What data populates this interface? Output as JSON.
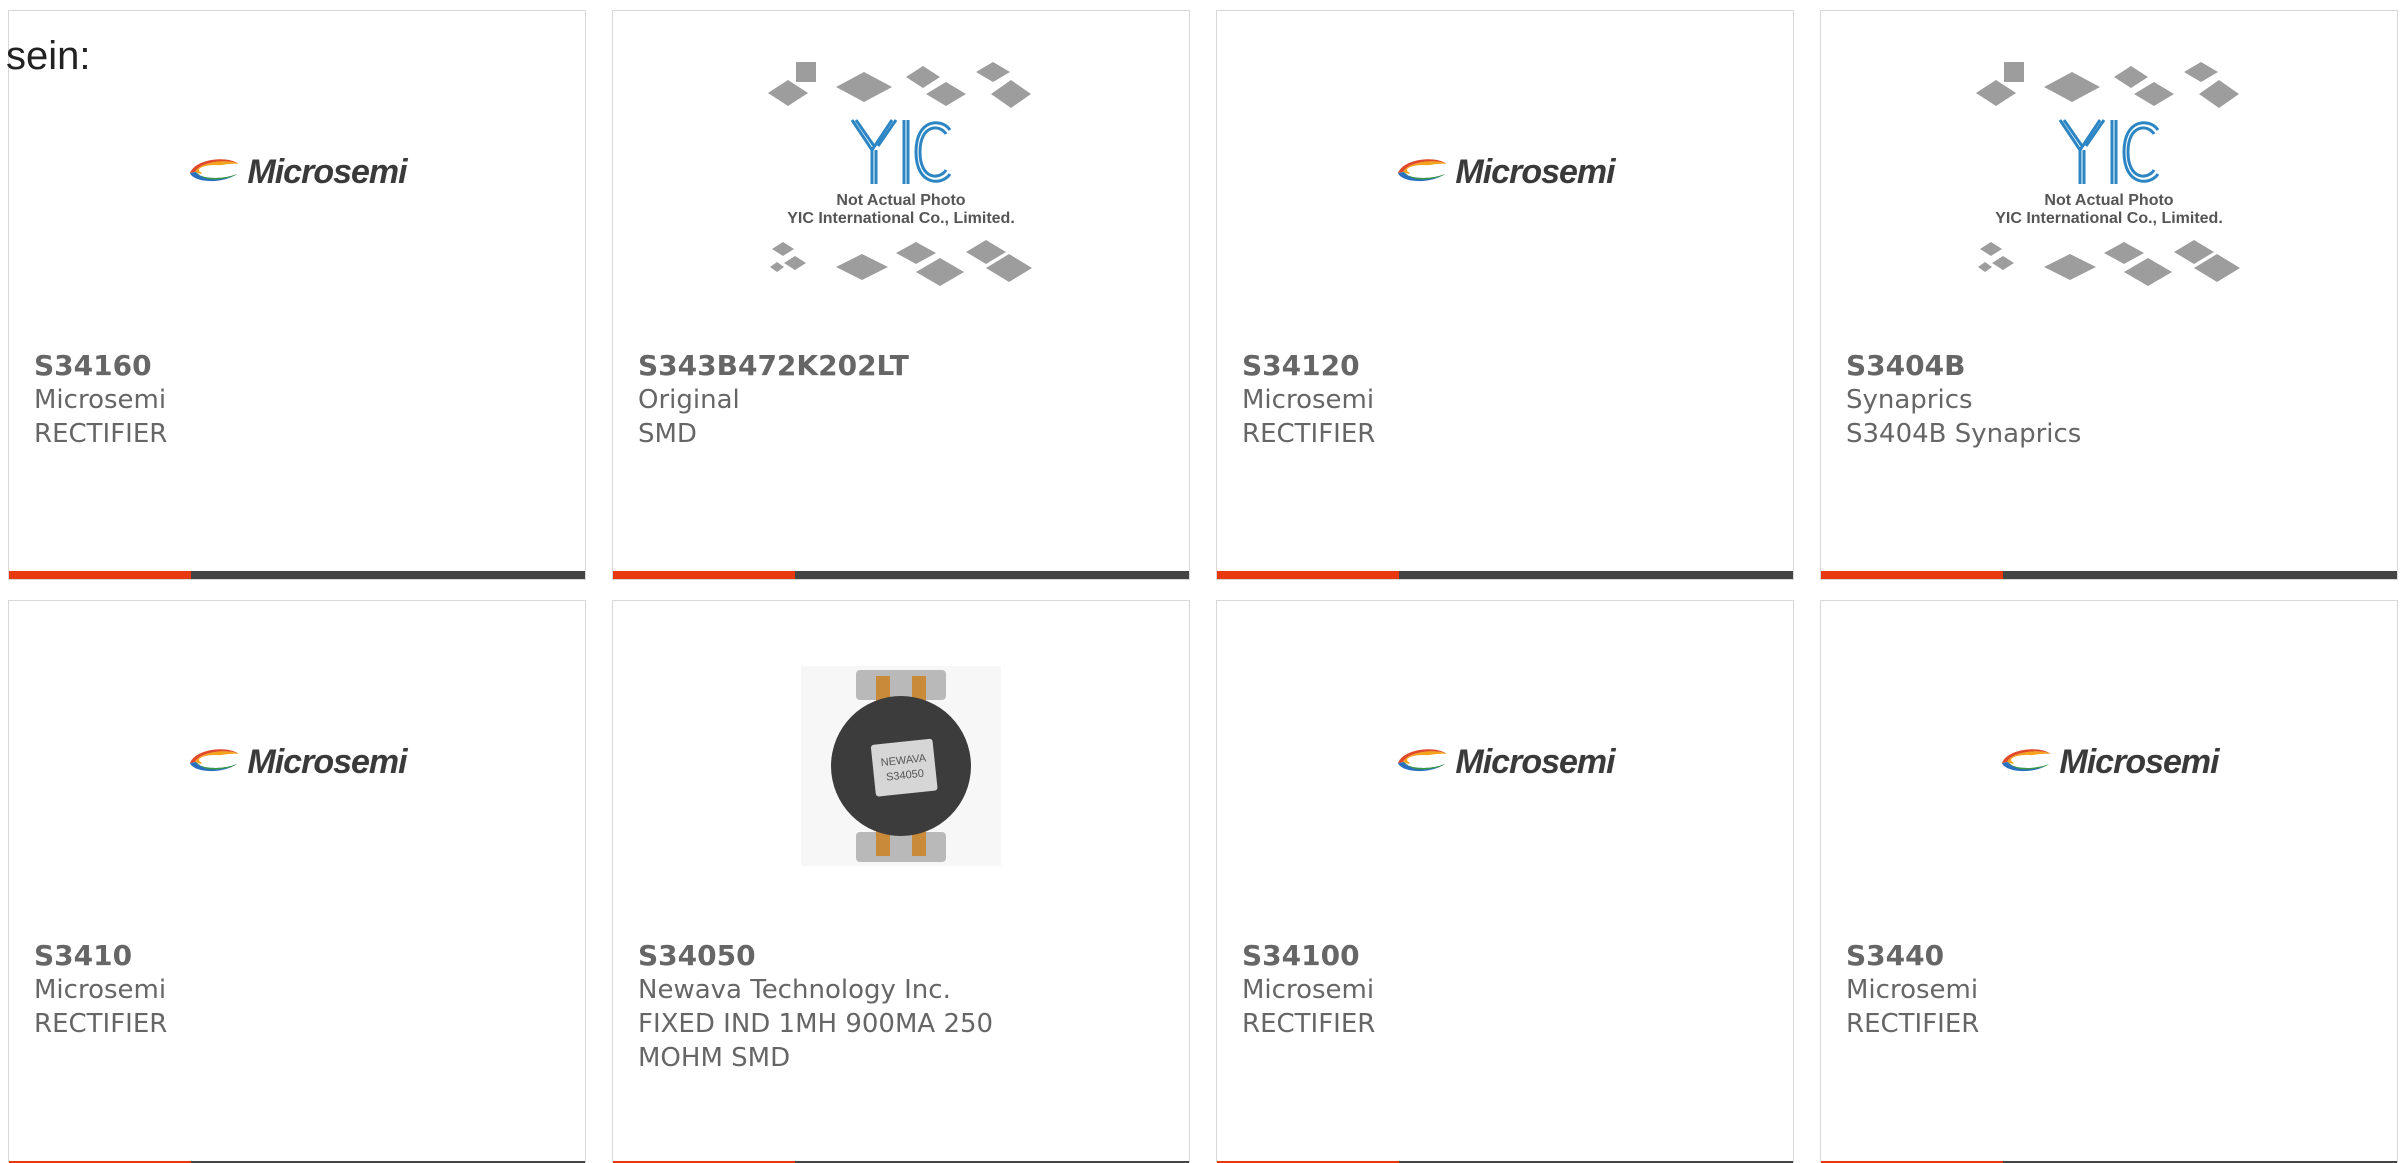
{
  "lead_text": "sein:",
  "colors": {
    "accent": "#e8390e",
    "bar": "#444444",
    "text": "#666666",
    "border": "#d8d8d8"
  },
  "products": [
    {
      "part_number": "S34160",
      "manufacturer": "Microsemi",
      "description_lines": [
        "RECTIFIER"
      ],
      "image": {
        "kind": "logo",
        "label": "Microsemi"
      }
    },
    {
      "part_number": "S343B472K202LT",
      "manufacturer": "Original",
      "description_lines": [
        "SMD"
      ],
      "image": {
        "kind": "placeholder",
        "label": "YIC",
        "caption1": "Not Actual Photo",
        "caption2": "YIC International Co., Limited."
      }
    },
    {
      "part_number": "S34120",
      "manufacturer": "Microsemi",
      "description_lines": [
        "RECTIFIER"
      ],
      "image": {
        "kind": "logo",
        "label": "Microsemi"
      }
    },
    {
      "part_number": "S3404B",
      "manufacturer": "Synaprics",
      "description_lines": [
        "S3404B Synaprics"
      ],
      "image": {
        "kind": "placeholder",
        "label": "YIC",
        "caption1": "Not Actual Photo",
        "caption2": "YIC International Co., Limited."
      }
    },
    {
      "part_number": "S3410",
      "manufacturer": "Microsemi",
      "description_lines": [
        "RECTIFIER"
      ],
      "image": {
        "kind": "logo",
        "label": "Microsemi"
      }
    },
    {
      "part_number": "S34050",
      "manufacturer": "Newava Technology Inc.",
      "description_lines": [
        "FIXED IND 1MH 900MA 250",
        "MOHM SMD"
      ],
      "image": {
        "kind": "photo",
        "label": "NEWAVA",
        "sublabel": "S34050"
      }
    },
    {
      "part_number": "S34100",
      "manufacturer": "Microsemi",
      "description_lines": [
        "RECTIFIER"
      ],
      "image": {
        "kind": "logo",
        "label": "Microsemi"
      }
    },
    {
      "part_number": "S3440",
      "manufacturer": "Microsemi",
      "description_lines": [
        "RECTIFIER"
      ],
      "image": {
        "kind": "logo",
        "label": "Microsemi"
      }
    }
  ]
}
